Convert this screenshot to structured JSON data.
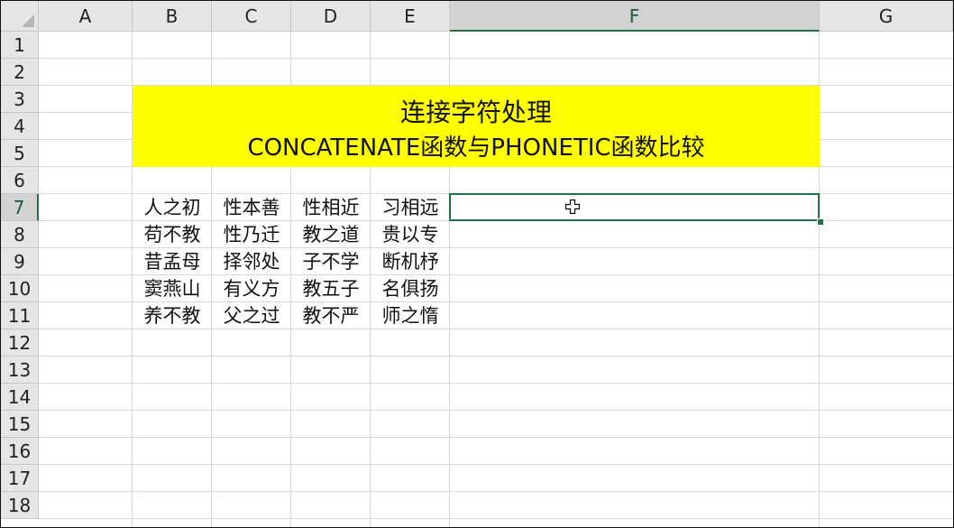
{
  "columns": [
    "A",
    "B",
    "C",
    "D",
    "E",
    "F",
    "G"
  ],
  "active_column": "F",
  "rows": [
    "1",
    "2",
    "3",
    "4",
    "5",
    "6",
    "7",
    "8",
    "9",
    "10",
    "11",
    "12",
    "13",
    "14",
    "15",
    "16",
    "17",
    "18"
  ],
  "active_row": "7",
  "title": {
    "line1": "连接字符处理",
    "line2": "CONCATENATE函数与PHONETIC函数比较"
  },
  "title_fill": "#ffff00",
  "data_rows": [
    [
      "人之初",
      "性本善",
      "性相近",
      "习相远"
    ],
    [
      "苟不教",
      "性乃迁",
      "教之道",
      "贵以专"
    ],
    [
      "昔孟母",
      "择邻处",
      "子不学",
      "断机杼"
    ],
    [
      "窦燕山",
      "有义方",
      "教五子",
      "名俱扬"
    ],
    [
      "养不教",
      "父之过",
      "教不严",
      "师之惰"
    ]
  ],
  "selected_cell": "F7",
  "selection_color": "#217346",
  "cursor_icon": "cell-select-cross-icon"
}
